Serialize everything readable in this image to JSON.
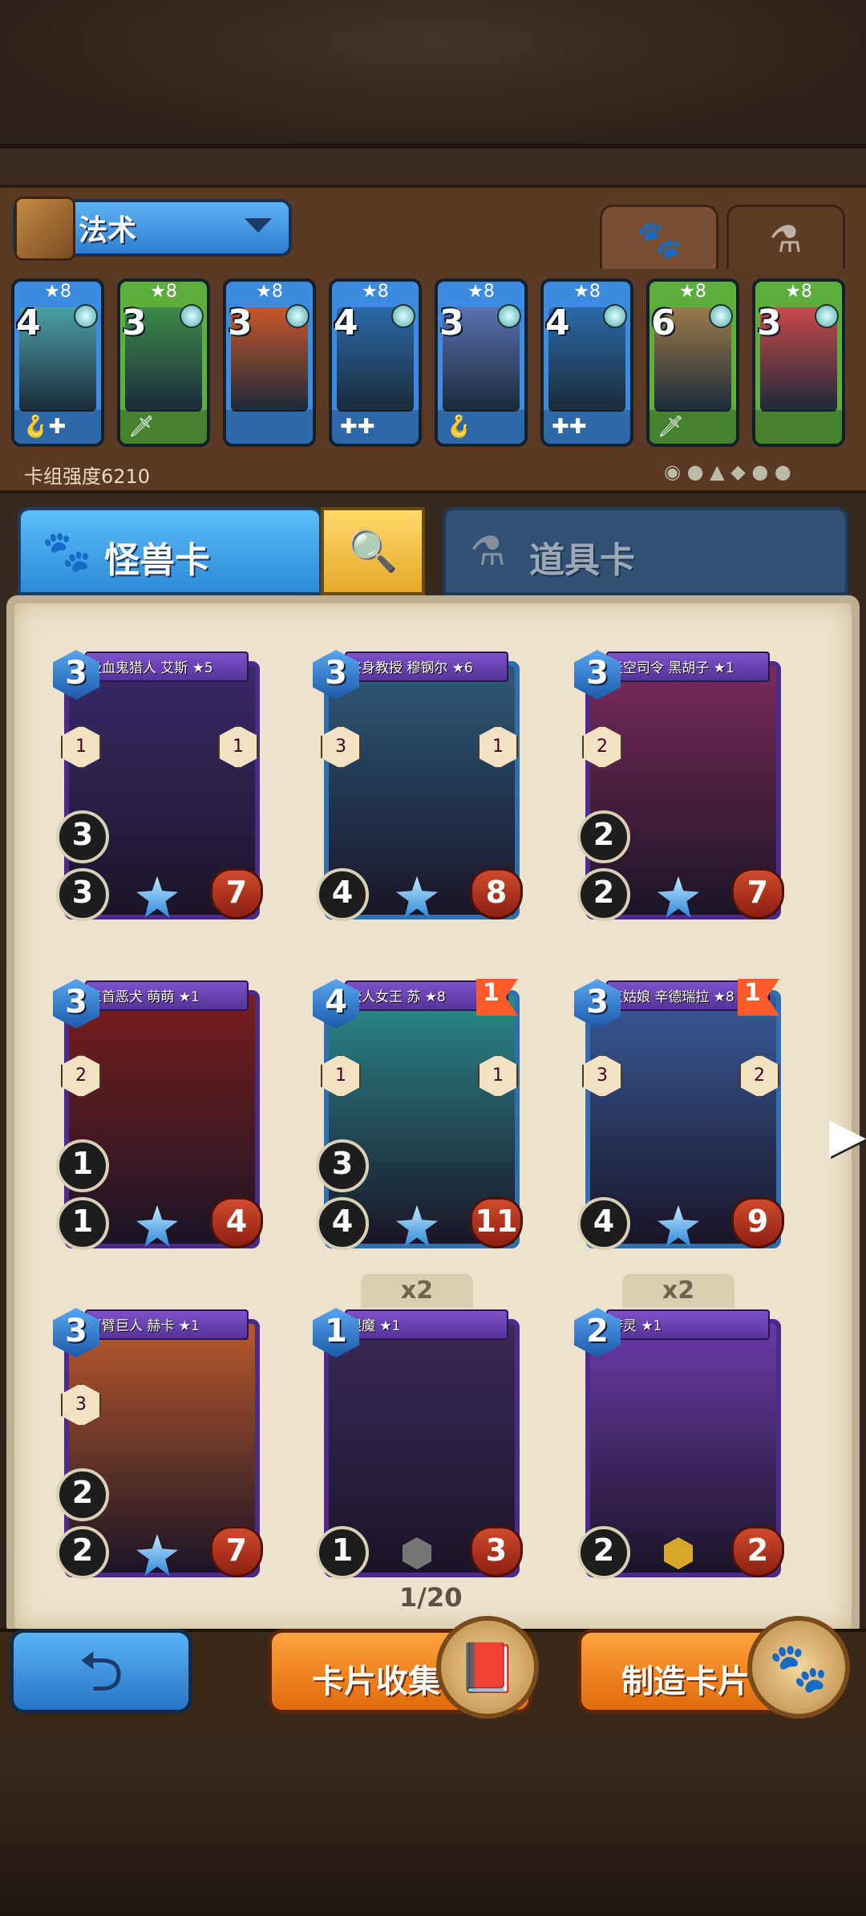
{
  "deck": {
    "name": "法术",
    "power_label": "卡组强度6210",
    "tabs": [
      {
        "icon": "paw-icon"
      },
      {
        "icon": "potion-icon"
      }
    ],
    "cards": [
      {
        "stars": "★8",
        "cost": "4",
        "color": "#3d8be0",
        "art": "#4aa0a4",
        "icons": "🪝✚"
      },
      {
        "stars": "★8",
        "cost": "3",
        "color": "#5cae3c",
        "art": "#3c8a4a",
        "icons": "🗡"
      },
      {
        "stars": "★8",
        "cost": "3",
        "color": "#3d8be0",
        "art": "#c8562a",
        "icons": ""
      },
      {
        "stars": "★8",
        "cost": "4",
        "color": "#3d8be0",
        "art": "#2a6aa8",
        "icons": "✚✚"
      },
      {
        "stars": "★8",
        "cost": "3",
        "color": "#3d8be0",
        "art": "#5a6fb0",
        "icons": "🪝"
      },
      {
        "stars": "★8",
        "cost": "4",
        "color": "#3d8be0",
        "art": "#2a6aa8",
        "icons": "✚✚"
      },
      {
        "stars": "★8",
        "cost": "6",
        "color": "#5cae3c",
        "art": "#9a7a48",
        "icons": "🗡"
      },
      {
        "stars": "★8",
        "cost": "3",
        "color": "#5cae3c",
        "art": "#c8484a",
        "icons": ""
      }
    ]
  },
  "categories": {
    "monster": "怪兽卡",
    "item": "道具卡"
  },
  "collection": [
    {
      "name": "吸血鬼猎人 艾斯 ★5",
      "cost": "3",
      "atk": "3",
      "spd": "3",
      "hp": "7",
      "frame": "#4b2a8a",
      "art": "#3a2a6a",
      "badgeL": "1",
      "badgeR": "1",
      "flag": "",
      "copies": ""
    },
    {
      "name": "终身教授 穆钢尔 ★6",
      "cost": "3",
      "atk": "4",
      "spd": "",
      "hp": "8",
      "frame": "#2f6fb0",
      "art": "#2c5a7a",
      "badgeL": "3",
      "badgeR": "1",
      "flag": "",
      "copies": ""
    },
    {
      "name": "天空司令 黑胡子 ★1",
      "cost": "3",
      "atk": "2",
      "spd": "2",
      "hp": "7",
      "frame": "#4b2a8a",
      "art": "#7a2a5a",
      "badgeL": "2",
      "badgeR": "",
      "flag": "",
      "copies": ""
    },
    {
      "name": "三首恶犬 萌萌 ★1",
      "cost": "3",
      "atk": "1",
      "spd": "1",
      "hp": "4",
      "frame": "#4b2a8a",
      "art": "#7a1e1e",
      "badgeL": "2",
      "badgeR": "",
      "flag": "",
      "copies": ""
    },
    {
      "name": "鲛人女王 苏 ★8",
      "cost": "4",
      "atk": "4",
      "spd": "3",
      "hp": "11",
      "frame": "#2f6fb0",
      "art": "#2a8a8a",
      "badgeL": "1",
      "badgeR": "1",
      "flag": "1",
      "copies": ""
    },
    {
      "name": "灰姑娘 辛德瑞拉 ★8",
      "cost": "3",
      "atk": "4",
      "spd": "",
      "hp": "9",
      "frame": "#2f6fb0",
      "art": "#3a5a9a",
      "badgeL": "3",
      "badgeR": "2",
      "flag": "1",
      "copies": ""
    },
    {
      "name": "百臂巨人 赫卡 ★1",
      "cost": "3",
      "atk": "2",
      "spd": "2",
      "hp": "7",
      "frame": "#4b2a8a",
      "art": "#b8582a",
      "badgeL": "3",
      "badgeR": "",
      "flag": "",
      "copies": ""
    },
    {
      "name": "眼魔 ★1",
      "cost": "1",
      "atk": "1",
      "spd": "",
      "hp": "3",
      "frame": "#4b2a8a",
      "art": "#3a2a5a",
      "badgeL": "",
      "badgeR": "",
      "flag": "",
      "copies": "x2"
    },
    {
      "name": "游灵 ★1",
      "cost": "2",
      "atk": "2",
      "spd": "",
      "hp": "2",
      "frame": "#4b2a8a",
      "art": "#6a3aa8",
      "badgeL": "",
      "badgeR": "",
      "flag": "",
      "copies": "x2"
    }
  ],
  "pager": "1/20",
  "buttons": {
    "collect": "卡片收集",
    "craft": "制造卡片"
  }
}
